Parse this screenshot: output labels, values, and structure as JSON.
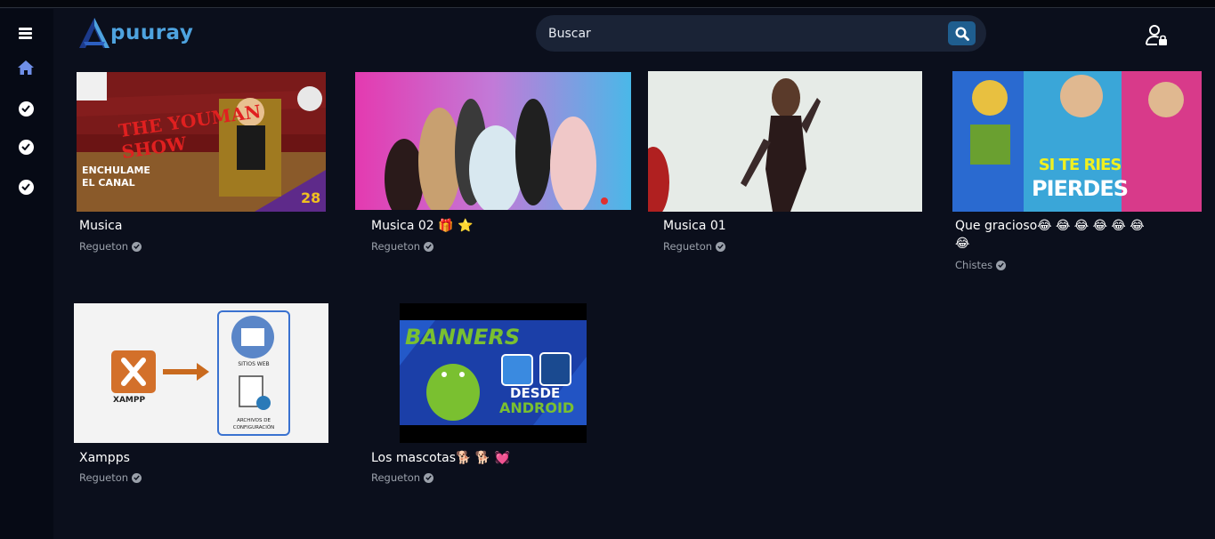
{
  "header": {
    "logo_text": "puuray",
    "search_placeholder": "Buscar"
  },
  "sidebar": {
    "icons": [
      "menu-icon",
      "home-icon",
      "check-circle-icon",
      "check-circle-icon",
      "check-circle-icon"
    ]
  },
  "videos": [
    {
      "title": "Musica",
      "channel": "Regueton",
      "thumb_text_1": "THE YOUMAN SHOW",
      "thumb_text_2": "ENCHULAME EL CANAL",
      "thumb_text_3": "28"
    },
    {
      "title": "Musica 02 🎁 ⭐",
      "channel": "Regueton"
    },
    {
      "title": "Musica 01",
      "channel": "Regueton"
    },
    {
      "title": "Que gracioso😂 😂 😂 😂 😂 😂",
      "title_line2": "😂",
      "channel": "Chistes",
      "thumb_text_1": "SI TE RIES",
      "thumb_text_2": "PIERDES"
    },
    {
      "title": "Xampps",
      "channel": "Regueton",
      "thumb_text_1": "XAMPP",
      "thumb_text_2": "SITIOS WEB",
      "thumb_text_3": "ARCHIVOS DE CONFIGURACIÓN"
    },
    {
      "title": "Los mascotas🐕 🐕 💓",
      "channel": "Regueton",
      "thumb_text_1": "BANNERS",
      "thumb_text_2": "DESDE",
      "thumb_text_3": "ANDROID"
    }
  ],
  "colors": {
    "background": "#0b0f1c",
    "sidebar": "#060a15",
    "accent": "#4ea3df",
    "search_bg": "#1a2336",
    "search_button": "#1f5e8f",
    "muted_text": "#9aa0aa"
  }
}
